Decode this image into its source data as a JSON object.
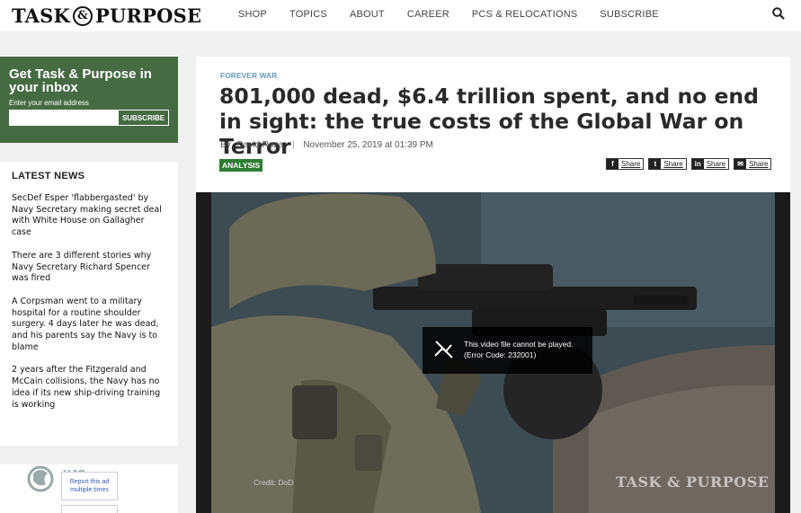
{
  "header": {
    "logo_left": "TASK",
    "logo_amp": "&",
    "logo_right": "PURPOSE",
    "nav": [
      "SHOP",
      "TOPICS",
      "ABOUT",
      "CAREER",
      "PCS & RELOCATIONS",
      "SUBSCRIBE"
    ],
    "search_icon": "search-icon"
  },
  "newsletter": {
    "title": "Get Task & Purpose in your inbox",
    "label": "Enter your email address",
    "input_value": "",
    "button": "SUBSCRIBE"
  },
  "latest_news": {
    "title": "LATEST NEWS",
    "items": [
      "SecDef Esper 'flabbergasted' by Navy Secretary making secret deal with White House on Gallagher case",
      "There are 3 different stories why Navy Secretary Richard Spencer was fired",
      "A Corpsman went to a military hospital for a routine shoulder surgery. 4 days later he was dead, and his parents say the Navy is to blame",
      "2 years after the Fitzgerald and McCain collisions, the Navy has no idea if its new ship-driving training is working"
    ]
  },
  "ad": {
    "overlay_text": "YJC",
    "report": "Report this ad multiple times"
  },
  "article": {
    "kicker": "FOREVER WAR",
    "headline": "801,000 dead, $6.4 trillion spent, and no end in sight: the true costs of the Global War on Terror",
    "byline_prefix": "By",
    "author": "David Roza",
    "date": "November 25, 2019 at 01:39 PM",
    "tag": "ANALYSIS",
    "shares": [
      {
        "icon": "f",
        "label": "Share"
      },
      {
        "icon": "t",
        "label": "Share"
      },
      {
        "icon": "in",
        "label": "Share"
      },
      {
        "icon": "✉",
        "label": "Share"
      }
    ]
  },
  "video": {
    "error_line1": "This video file cannot be played.",
    "error_line2": "(Error Code: 232001)",
    "credit": "Credit: DoD",
    "watermark": "TASK & PURPOSE"
  }
}
